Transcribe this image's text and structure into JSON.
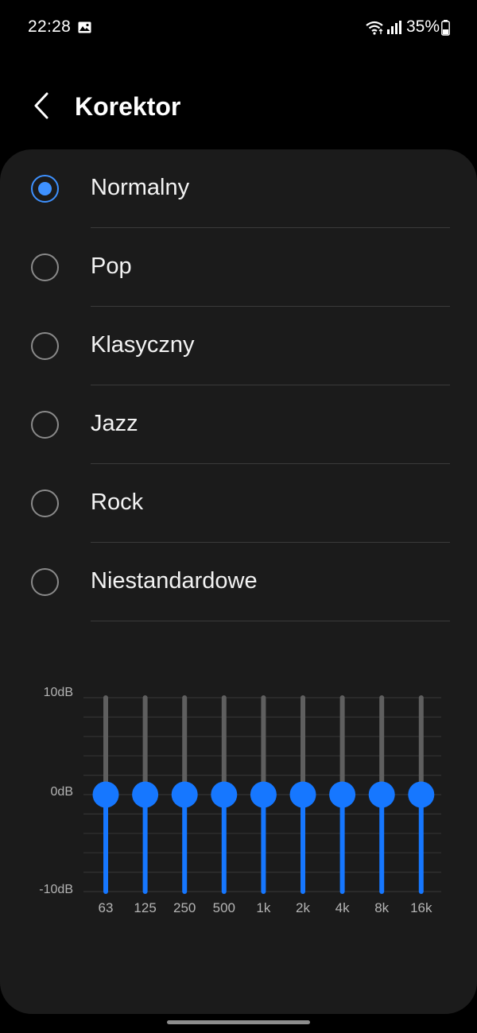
{
  "status_bar": {
    "time": "22:28",
    "battery": "35%",
    "icons": [
      "gallery-icon",
      "wifi-icon",
      "signal-icon",
      "battery-icon"
    ]
  },
  "header": {
    "title": "Korektor",
    "back_icon": "chevron-left-icon"
  },
  "presets": {
    "selected_index": 0,
    "items": [
      {
        "label": "Normalny"
      },
      {
        "label": "Pop"
      },
      {
        "label": "Klasyczny"
      },
      {
        "label": "Jazz"
      },
      {
        "label": "Rock"
      },
      {
        "label": "Niestandardowe"
      }
    ]
  },
  "equalizer": {
    "level_labels": {
      "top": "10dB",
      "mid": "0dB",
      "bottom": "-10dB"
    },
    "range_db": [
      -10,
      10
    ],
    "bands": [
      {
        "freq": "63",
        "gain_db": 0
      },
      {
        "freq": "125",
        "gain_db": 0
      },
      {
        "freq": "250",
        "gain_db": 0
      },
      {
        "freq": "500",
        "gain_db": 0
      },
      {
        "freq": "1k",
        "gain_db": 0
      },
      {
        "freq": "2k",
        "gain_db": 0
      },
      {
        "freq": "4k",
        "gain_db": 0
      },
      {
        "freq": "8k",
        "gain_db": 0
      },
      {
        "freq": "16k",
        "gain_db": 0
      }
    ]
  },
  "colors": {
    "accent": "#3e91ff",
    "slider_active": "#1677ff",
    "slider_track": "#5f5f5f",
    "card_bg": "#1b1b1b"
  }
}
